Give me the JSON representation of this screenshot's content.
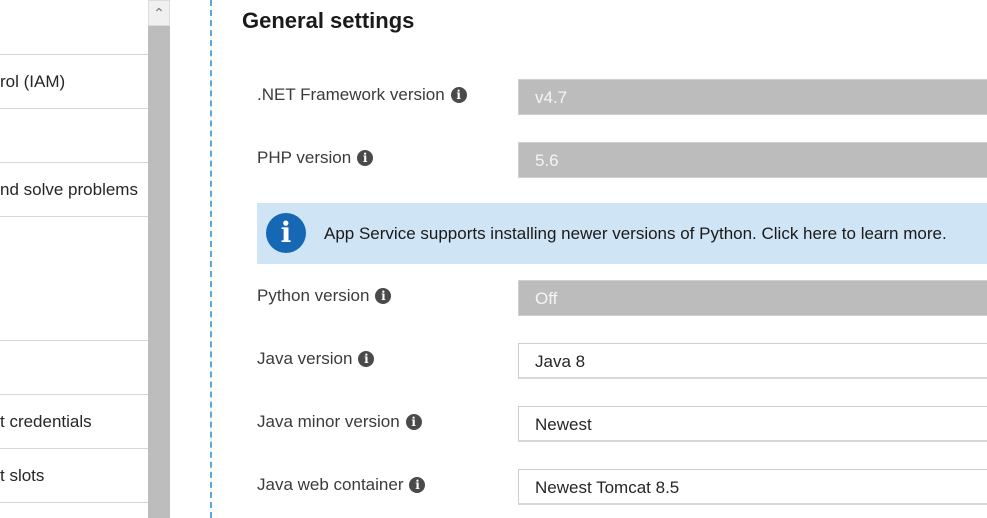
{
  "nav": {
    "items": [
      {
        "label": ""
      },
      {
        "label": "rol (IAM)"
      },
      {
        "label": ""
      },
      {
        "label": "nd solve problems"
      },
      {
        "label": ""
      },
      {
        "label": ""
      },
      {
        "label": "t credentials"
      },
      {
        "label": "t slots"
      }
    ]
  },
  "settings": {
    "title": "General settings",
    "rows": {
      "net_framework": {
        "label": ".NET Framework version",
        "value": "v4.7"
      },
      "php": {
        "label": "PHP version",
        "value": "5.6"
      },
      "python": {
        "label": "Python version",
        "value": "Off"
      },
      "java": {
        "label": "Java version",
        "value": "Java 8"
      },
      "java_minor": {
        "label": "Java minor version",
        "value": "Newest"
      },
      "java_container": {
        "label": "Java web container",
        "value": "Newest Tomcat 8.5"
      }
    },
    "info_banner": "App Service supports installing newer versions of Python. Click here to learn more."
  },
  "colors": {
    "banner_bg": "#cfe4f5",
    "banner_icon": "#1667b4",
    "disabled_field": "#bcbcbc",
    "divider": "#5aa9da"
  }
}
